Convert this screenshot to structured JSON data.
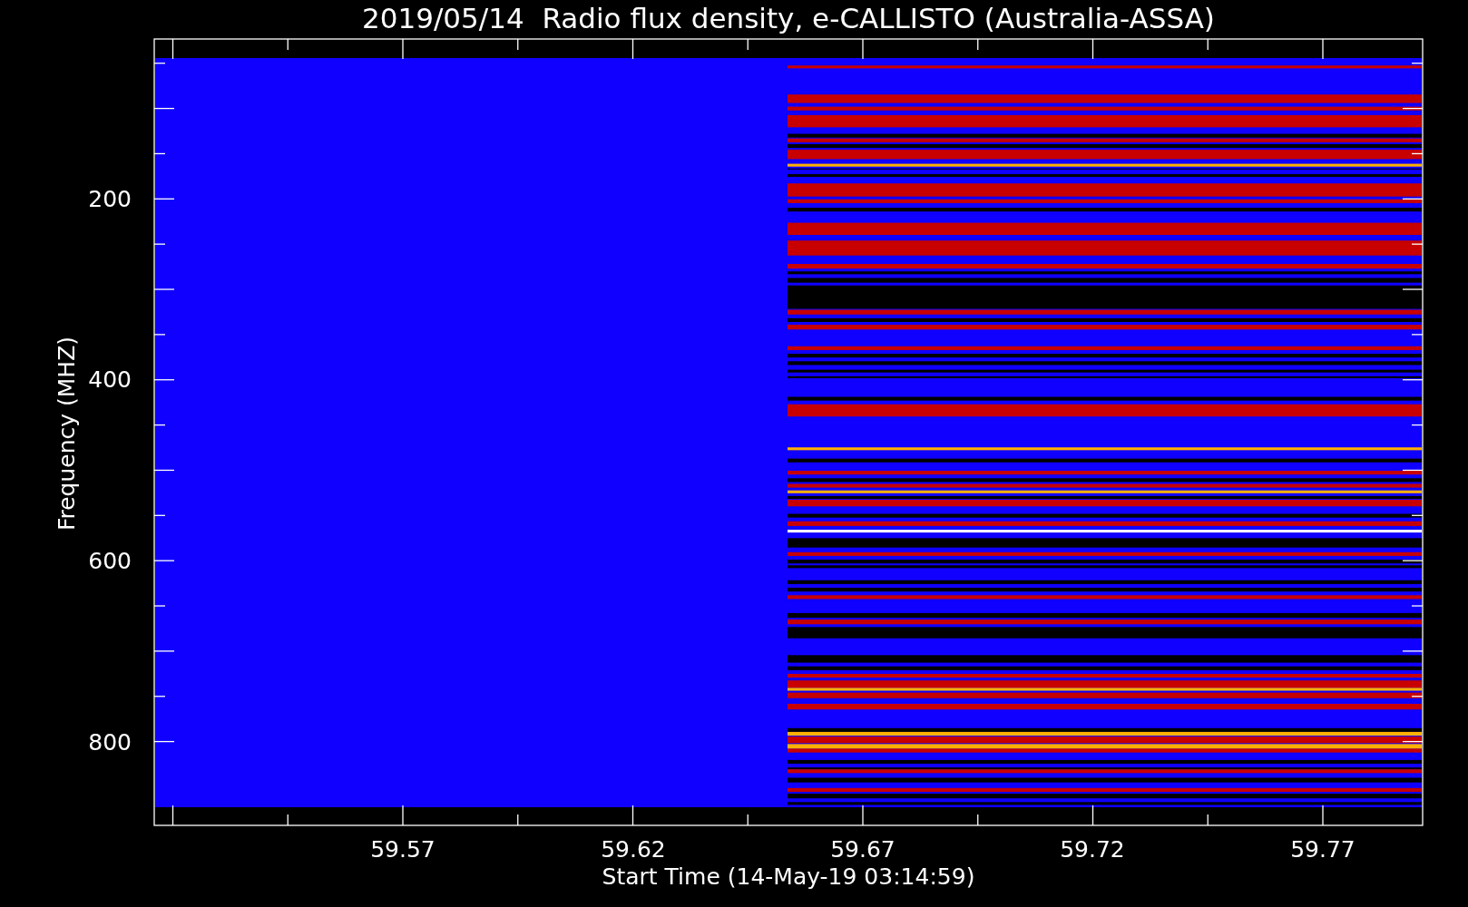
{
  "title": "2019/05/14  Radio flux density, e-CALLISTO (Australia-ASSA)",
  "y_axis": {
    "label": "Frequency (MHZ)",
    "ticks": [
      "200",
      "400",
      "600",
      "800"
    ]
  },
  "x_axis": {
    "label": "Start Time (14-May-19 03:14:59)",
    "ticks": [
      "59.57",
      "59.62",
      "59.67",
      "59.72",
      "59.77"
    ]
  }
}
